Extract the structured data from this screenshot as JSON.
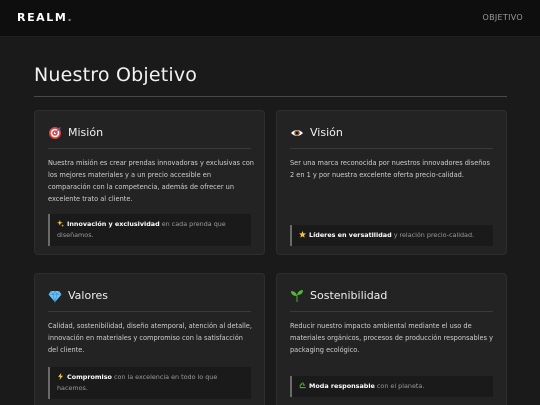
{
  "header": {
    "logo": "REALM",
    "logo_dot": ".",
    "nav_link": "OBJETIVO"
  },
  "page": {
    "title": "Nuestro Objetivo"
  },
  "cards": [
    {
      "icon": "target-icon",
      "title": "Misión",
      "body": "Nuestra misión es crear prendas innovadoras y exclusivas con los mejores materiales y a un precio accesible en comparación con la competencia, además de ofrecer un excelente trato al cliente.",
      "highlight_icon": "sparkles-icon",
      "highlight_strong": "Innovación y exclusividad",
      "highlight_text": " en cada prenda que diseñamos."
    },
    {
      "icon": "eye-icon",
      "title": "Visión",
      "body": "Ser una marca reconocida por nuestros innovadores diseños 2 en 1 y por nuestra excelente oferta precio-calidad.",
      "highlight_icon": "star-icon",
      "highlight_strong": "Líderes en versatilidad",
      "highlight_text": " y relación precio-calidad."
    },
    {
      "icon": "gem-icon",
      "title": "Valores",
      "body": "Calidad, sostenibilidad, diseño atemporal, atención al detalle, innovación en materiales y compromiso con la satisfacción del cliente.",
      "highlight_icon": "lightning-icon",
      "highlight_strong": "Compromiso",
      "highlight_text": " con la excelencia en todo lo que hacemos."
    },
    {
      "icon": "seedling-icon",
      "title": "Sostenibilidad",
      "body": "Reducir nuestro impacto ambiental mediante el uso de materiales orgánicos, procesos de producción responsables y packaging ecológico.",
      "highlight_icon": "recycle-icon",
      "highlight_strong": "Moda responsable",
      "highlight_text": " con el planeta."
    }
  ],
  "colors": {
    "background": "#1a1a1a",
    "header": "#0e0e0e",
    "card": "#232323",
    "accent_red": "#e0413a",
    "accent_green": "#52b83a",
    "accent_blue": "#6fc4f2",
    "accent_yellow": "#f5c542"
  }
}
